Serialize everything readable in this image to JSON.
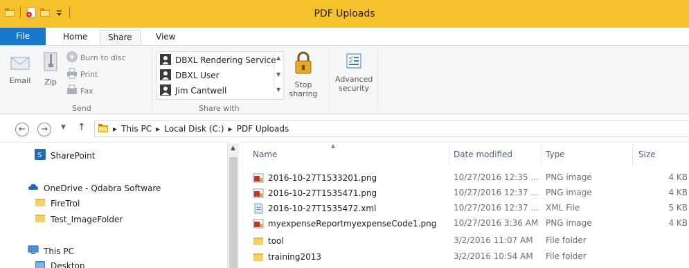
{
  "window": {
    "title": "PDF Uploads"
  },
  "colors": {
    "titlebar": "#f5c22b",
    "file_tab": "#1979ca",
    "ribbon_bg": "#f5f6f7",
    "header_text": "#4c607a"
  },
  "ribbon": {
    "tabs": [
      "File",
      "Home",
      "Share",
      "View"
    ],
    "active_tab": "Share",
    "send_group": {
      "email": "Email",
      "zip": "Zip",
      "burn": "Burn to disc",
      "print": "Print",
      "fax": "Fax",
      "label": "Send"
    },
    "share_with_group": {
      "users": [
        "DBXL Rendering Service",
        "DBXL User",
        "Jim Cantwell"
      ],
      "stop_sharing": [
        "Stop",
        "sharing"
      ],
      "label": "Share with"
    },
    "advanced_security": [
      "Advanced",
      "security"
    ]
  },
  "address": {
    "back_icon": "back-arrow-icon",
    "forward_icon": "forward-arrow-icon",
    "path": [
      "This PC",
      "Local Disk (C:)",
      "PDF Uploads"
    ]
  },
  "nav_pane": {
    "items": [
      {
        "label": "SharePoint",
        "icon": "sharepoint-icon"
      },
      {
        "label": "OneDrive - Qdabra Software",
        "icon": "cloud-icon"
      },
      {
        "label": "FireTrol",
        "icon": "folder-icon"
      },
      {
        "label": "Test_ImageFolder",
        "icon": "folder-icon"
      },
      {
        "label": "This PC",
        "icon": "computer-icon"
      },
      {
        "label": "Desktop",
        "icon": "desktop-folder-icon"
      }
    ]
  },
  "file_list": {
    "columns": {
      "name": "Name",
      "date": "Date modified",
      "type": "Type",
      "size": "Size"
    },
    "rows": [
      {
        "name": "2016-10-27T1533201.png",
        "date": "10/27/2016 12:35 ...",
        "type": "PNG image",
        "size": "4 KB",
        "icon": "png-file-icon"
      },
      {
        "name": "2016-10-27T1535471.png",
        "date": "10/27/2016 12:37 ...",
        "type": "PNG image",
        "size": "4 KB",
        "icon": "png-file-icon"
      },
      {
        "name": "2016-10-27T1535472.xml",
        "date": "10/27/2016 12:37 ...",
        "type": "XML File",
        "size": "5 KB",
        "icon": "xml-file-icon"
      },
      {
        "name": "myexpenseReportmyexpenseCode1.png",
        "date": "10/27/2016 3:36 AM",
        "type": "PNG image",
        "size": "4 KB",
        "icon": "png-file-icon"
      },
      {
        "name": "tool",
        "date": "3/2/2016 11:07 AM",
        "type": "File folder",
        "size": "",
        "icon": "folder-icon"
      },
      {
        "name": "training2013",
        "date": "3/2/2016 10:54 AM",
        "type": "File folder",
        "size": "",
        "icon": "folder-icon"
      }
    ]
  }
}
